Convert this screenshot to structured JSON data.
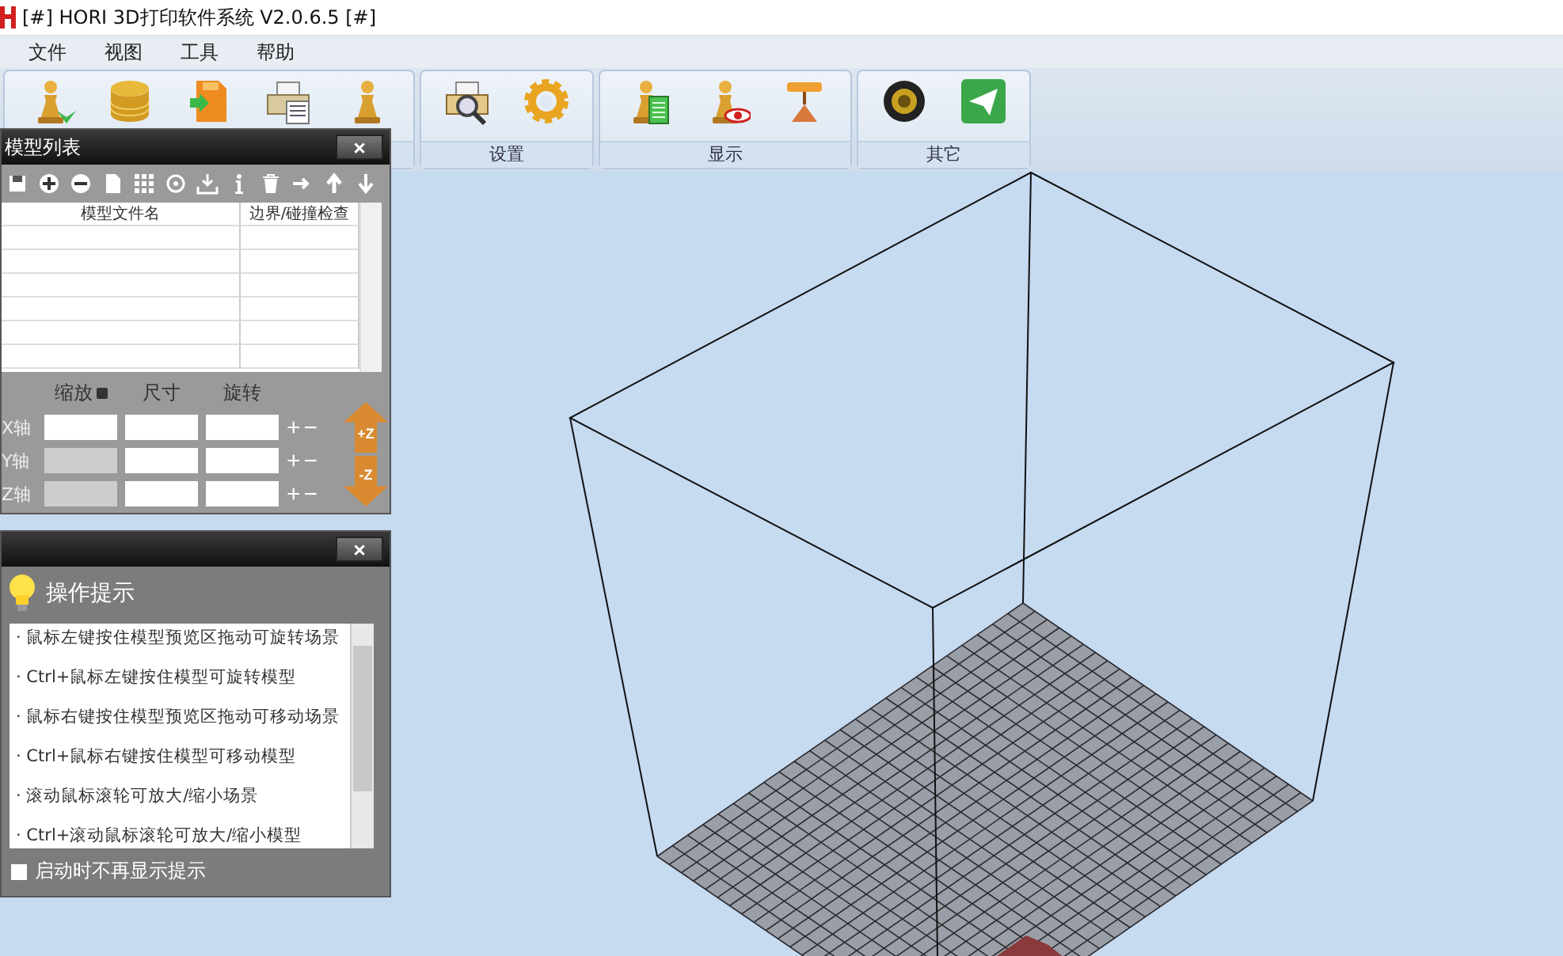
{
  "window": {
    "title": "[#] HORI 3D打印软件系统 V2.0.6.5 [#]"
  },
  "menu": [
    "文件",
    "视图",
    "工具",
    "帮助"
  ],
  "toolbar_groups": [
    {
      "icons": [
        {
          "kind": "pawn-add"
        },
        {
          "kind": "database"
        },
        {
          "kind": "sd-card"
        },
        {
          "kind": "printer"
        },
        {
          "kind": "pawn"
        }
      ]
    },
    {
      "label": "设置",
      "icons": [
        {
          "kind": "printer-search"
        },
        {
          "kind": "gear"
        }
      ]
    },
    {
      "label": "显示",
      "icons": [
        {
          "kind": "pawn-sheet"
        },
        {
          "kind": "pawn-eye"
        },
        {
          "kind": "nozzle"
        }
      ]
    },
    {
      "label": "其它",
      "icons": [
        {
          "kind": "lens"
        },
        {
          "kind": "send"
        }
      ]
    }
  ],
  "model_list": {
    "title": "模型列表",
    "close_label": "×",
    "tools": [
      {
        "kind": "save"
      },
      {
        "kind": "add"
      },
      {
        "kind": "remove"
      },
      {
        "kind": "page"
      },
      {
        "kind": "grid"
      },
      {
        "kind": "target"
      },
      {
        "kind": "import"
      },
      {
        "kind": "info"
      },
      {
        "kind": "delete"
      },
      {
        "kind": "right"
      },
      {
        "kind": "up"
      },
      {
        "kind": "down"
      }
    ],
    "columns": [
      "模型文件名",
      "边界/碰撞检查"
    ]
  },
  "transform": {
    "headers": [
      "缩放",
      "尺寸",
      "旋转"
    ],
    "axes": [
      {
        "label": "X轴",
        "scale_disabled": false,
        "plus": "+",
        "minus": "−"
      },
      {
        "label": "Y轴",
        "scale_disabled": true,
        "plus": "+",
        "minus": "−"
      },
      {
        "label": "Z轴",
        "scale_disabled": true,
        "plus": "+",
        "minus": "−"
      }
    ],
    "up_label": "+Z",
    "down_label": "-Z"
  },
  "tips": {
    "title": "操作提示",
    "close_label": "×",
    "items": [
      "· 鼠标左键按住模型预览区拖动可旋转场景",
      "· Ctrl+鼠标左键按住模型可旋转模型",
      "· 鼠标右键按住模型预览区拖动可移动场景",
      "· Ctrl+鼠标右键按住模型可移动模型",
      "· 滚动鼠标滚轮可放大/缩小场景",
      "· Ctrl+滚动鼠标滚轮可放大/缩小模型"
    ],
    "dont_show": {
      "label": "启动时不再显示提示",
      "checked": false
    }
  }
}
